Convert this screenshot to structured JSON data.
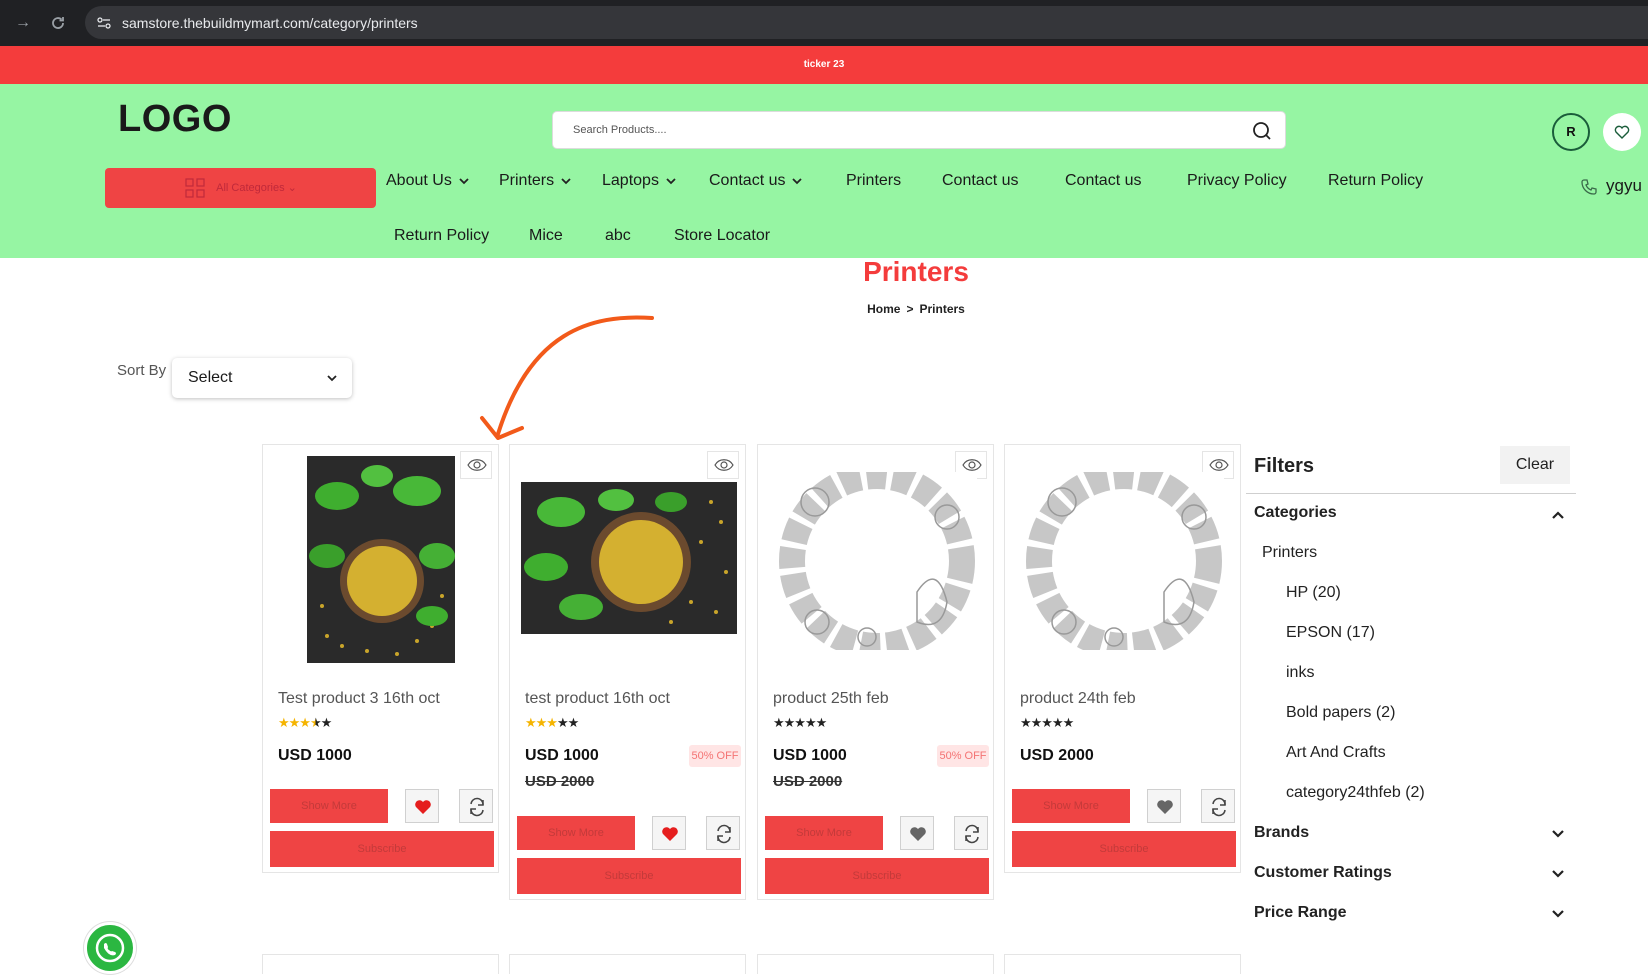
{
  "browser": {
    "url": "samstore.thebuildmymart.com/category/printers"
  },
  "ticker": {
    "text": "ticker 23"
  },
  "header": {
    "logo": "LOGO",
    "search_placeholder": "Search Products....",
    "user_initial": "R",
    "all_categories_label": "All Categories ⌄",
    "phone_text": "ygyu",
    "accent_color": "#96f5a3",
    "menu": [
      {
        "label": "About Us",
        "dropdown": true
      },
      {
        "label": "Printers",
        "dropdown": true
      },
      {
        "label": "Laptops",
        "dropdown": true
      },
      {
        "label": "Contact us",
        "dropdown": true
      },
      {
        "label": "Printers",
        "dropdown": false
      },
      {
        "label": "Contact us",
        "dropdown": false
      },
      {
        "label": "Contact us",
        "dropdown": false
      },
      {
        "label": "Privacy Policy",
        "dropdown": false
      },
      {
        "label": "Return Policy",
        "dropdown": false
      },
      {
        "label": "Return Policy",
        "dropdown": false
      },
      {
        "label": "Mice",
        "dropdown": false
      },
      {
        "label": "abc",
        "dropdown": false
      },
      {
        "label": "Store Locator",
        "dropdown": false
      }
    ]
  },
  "page": {
    "title": "Printers",
    "breadcrumb": [
      "Home",
      "Printers"
    ],
    "breadcrumb_sep": ">",
    "sort_label": "Sort By",
    "sort_value": "Select"
  },
  "products": [
    {
      "name": "Test product 3 16th oct",
      "rating": 3.5,
      "price": "USD 1000",
      "old_price": "",
      "discount": "",
      "wishlisted": true,
      "image": "fenugreek-portrait",
      "show_more": "Show More",
      "subscribe": "Subscribe"
    },
    {
      "name": "test product 16th oct",
      "rating": 3,
      "price": "USD 1000",
      "old_price": "USD 2000",
      "discount": "50% OFF",
      "wishlisted": true,
      "image": "fenugreek-landscape",
      "show_more": "Show More",
      "subscribe": "Subscribe"
    },
    {
      "name": "product 25th feb",
      "rating": 0,
      "price": "USD 1000",
      "old_price": "USD 2000",
      "discount": "50% OFF",
      "wishlisted": false,
      "image": "placeholder-sketch",
      "show_more": "Show More",
      "subscribe": "Subscribe"
    },
    {
      "name": "product 24th feb",
      "rating": 0,
      "price": "USD 2000",
      "old_price": "",
      "discount": "",
      "wishlisted": false,
      "image": "placeholder-sketch",
      "show_more": "Show More",
      "subscribe": "Subscribe"
    }
  ],
  "filters": {
    "title": "Filters",
    "clear_label": "Clear",
    "categories_label": "Categories",
    "category_parent": "Printers",
    "category_children": [
      "HP (20)",
      "EPSON (17)",
      "inks",
      "Bold papers (2)",
      "Art And Crafts",
      "category24thfeb (2)"
    ],
    "brands_label": "Brands",
    "ratings_label": "Customer Ratings",
    "price_label": "Price Range"
  }
}
